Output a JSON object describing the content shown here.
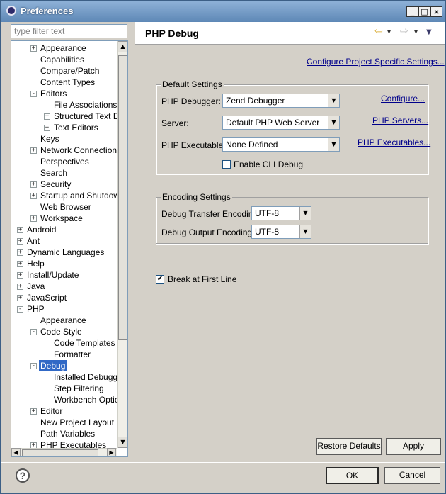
{
  "window": {
    "title": "Preferences",
    "btn_min": "_",
    "btn_max": "□",
    "btn_close": "x"
  },
  "filter": {
    "placeholder": "type filter text"
  },
  "tree": [
    {
      "label": "Appearance",
      "level": 1,
      "expander": "+"
    },
    {
      "label": "Capabilities",
      "level": 1,
      "expander": ""
    },
    {
      "label": "Compare/Patch",
      "level": 1,
      "expander": ""
    },
    {
      "label": "Content Types",
      "level": 1,
      "expander": ""
    },
    {
      "label": "Editors",
      "level": 1,
      "expander": "-"
    },
    {
      "label": "File Associations",
      "level": 2,
      "expander": ""
    },
    {
      "label": "Structured Text Ed",
      "level": 2,
      "expander": "+"
    },
    {
      "label": "Text Editors",
      "level": 2,
      "expander": "+"
    },
    {
      "label": "Keys",
      "level": 1,
      "expander": ""
    },
    {
      "label": "Network Connections",
      "level": 1,
      "expander": "+"
    },
    {
      "label": "Perspectives",
      "level": 1,
      "expander": ""
    },
    {
      "label": "Search",
      "level": 1,
      "expander": ""
    },
    {
      "label": "Security",
      "level": 1,
      "expander": "+"
    },
    {
      "label": "Startup and Shutdown",
      "level": 1,
      "expander": "+"
    },
    {
      "label": "Web Browser",
      "level": 1,
      "expander": ""
    },
    {
      "label": "Workspace",
      "level": 1,
      "expander": "+"
    },
    {
      "label": "Android",
      "level": 0,
      "expander": "+"
    },
    {
      "label": "Ant",
      "level": 0,
      "expander": "+"
    },
    {
      "label": "Dynamic Languages",
      "level": 0,
      "expander": "+"
    },
    {
      "label": "Help",
      "level": 0,
      "expander": "+"
    },
    {
      "label": "Install/Update",
      "level": 0,
      "expander": "+"
    },
    {
      "label": "Java",
      "level": 0,
      "expander": "+"
    },
    {
      "label": "JavaScript",
      "level": 0,
      "expander": "+"
    },
    {
      "label": "PHP",
      "level": 0,
      "expander": "-"
    },
    {
      "label": "Appearance",
      "level": 1,
      "expander": ""
    },
    {
      "label": "Code Style",
      "level": 1,
      "expander": "-"
    },
    {
      "label": "Code Templates",
      "level": 2,
      "expander": ""
    },
    {
      "label": "Formatter",
      "level": 2,
      "expander": ""
    },
    {
      "label": "Debug",
      "level": 1,
      "expander": "-",
      "selected": true
    },
    {
      "label": "Installed Debuggers",
      "level": 2,
      "expander": ""
    },
    {
      "label": "Step Filtering",
      "level": 2,
      "expander": ""
    },
    {
      "label": "Workbench Options",
      "level": 2,
      "expander": ""
    },
    {
      "label": "Editor",
      "level": 1,
      "expander": "+"
    },
    {
      "label": "New Project Layout",
      "level": 1,
      "expander": ""
    },
    {
      "label": "Path Variables",
      "level": 1,
      "expander": ""
    },
    {
      "label": "PHP Executables",
      "level": 1,
      "expander": "+"
    }
  ],
  "scroll": {
    "up_glyph": "▲",
    "down_glyph": "▼",
    "left_glyph": "◀",
    "right_glyph": "▶"
  },
  "header": {
    "title": "PHP Debug",
    "back_glyph": "⇦",
    "forward_glyph": "⇨",
    "menu_glyph": "▾",
    "view_menu_glyph": "▼"
  },
  "main": {
    "configure_project_link": "Configure Project Specific Settings...",
    "default_settings": {
      "title": "Default Settings",
      "debugger_label": "PHP Debugger:",
      "debugger_value": "Zend Debugger",
      "configure_link": "Configure...",
      "server_label": "Server:",
      "server_value": "Default PHP Web Server",
      "servers_link": "PHP Servers...",
      "executable_label": "PHP Executable:",
      "executable_value": "None Defined",
      "executables_link": "PHP Executables...",
      "cli_debug_label": "Enable CLI Debug",
      "cli_debug_checked": false
    },
    "encoding_settings": {
      "title": "Encoding Settings",
      "transfer_label": "Debug Transfer Encoding",
      "transfer_value": "UTF-8",
      "output_label": "Debug Output Encoding",
      "output_value": "UTF-8"
    },
    "break_first_line_label": "Break at First Line",
    "break_first_line_checked": true,
    "check_glyph": "✔",
    "combo_arrow_glyph": "▼",
    "restore_defaults_label": "Restore Defaults",
    "apply_label": "Apply"
  },
  "footer": {
    "help_glyph": "?",
    "ok_label": "OK",
    "cancel_label": "Cancel"
  }
}
